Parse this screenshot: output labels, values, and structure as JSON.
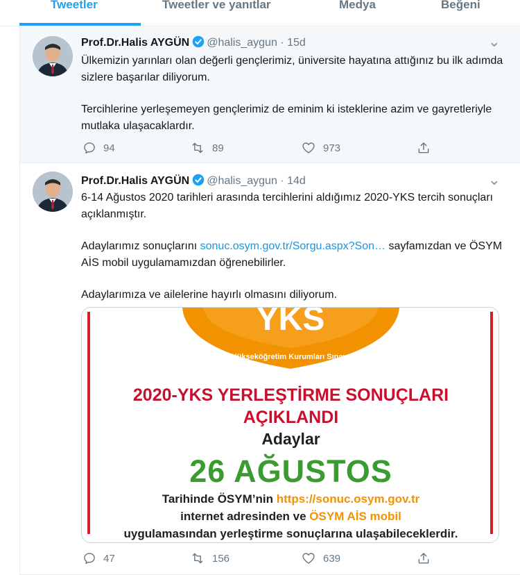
{
  "tabs": [
    {
      "label": "Tweetler",
      "active": true
    },
    {
      "label": "Tweetler ve yanıtlar",
      "active": false
    },
    {
      "label": "Medya",
      "active": false
    },
    {
      "label": "Beğeni",
      "active": false
    }
  ],
  "colors": {
    "accent": "#1da1f2",
    "link": "#1b95e0",
    "muted": "#657786",
    "card_red": "#c8102e",
    "card_green": "#3a9b2f",
    "card_orange": "#f39200"
  },
  "tweets": [
    {
      "author_name": "Prof.Dr.Halis AYGÜN",
      "handle": "@halis_aygun",
      "time": "· 15d",
      "caret": "⌄",
      "paragraphs": [
        "Ülkemizin yarınları olan değerli gençlerimiz, üniversite hayatına attığınız bu ilk adımda sizlere başarılar diliyorum.",
        "Tercihlerine yerleşemeyen gençlerimiz de eminim ki isteklerine azim ve gayretleriyle mutlaka ulaşacaklardır."
      ],
      "replies": "94",
      "retweets": "89",
      "likes": "973"
    },
    {
      "author_name": "Prof.Dr.Halis AYGÜN",
      "handle": "@halis_aygun",
      "time": "· 14d",
      "caret": "⌄",
      "p1": "6-14 Ağustos 2020 tarihleri arasında tercihlerini aldığımız 2020-YKS tercih sonuçları açıklanmıştır.",
      "p2_before": "Adaylarımız sonuçlarını ",
      "p2_link": "sonuc.osym.gov.tr/Sorgu.aspx?Son…",
      "p2_after": " sayfamızdan ve ÖSYM AİS mobil uygulamamızdan öğrenebilirler.",
      "p3": "Adaylarımıza ve ailelerine hayırlı olmasını diliyorum.",
      "card": {
        "logo_text": "YKS",
        "logo_subtitle": "Yükseköğretim Kurumları Sınavı",
        "title_line1": "2020-YKS YERLEŞTİRME SONUÇLARI",
        "title_line2": "AÇIKLANDI",
        "adaylar": "Adaylar",
        "date": "26 AĞUSTOS",
        "info_prefix": "Tarihinde ÖSYM’nin ",
        "info_url": "https://sonuc.osym.gov.tr",
        "info_mid": "internet adresinden ve ",
        "info_app": "ÖSYM AİS mobil",
        "info_end": "uygulamasından yerleştirme sonuçlarına ulaşabileceklerdir."
      },
      "replies": "47",
      "retweets": "156",
      "likes": "639"
    }
  ]
}
